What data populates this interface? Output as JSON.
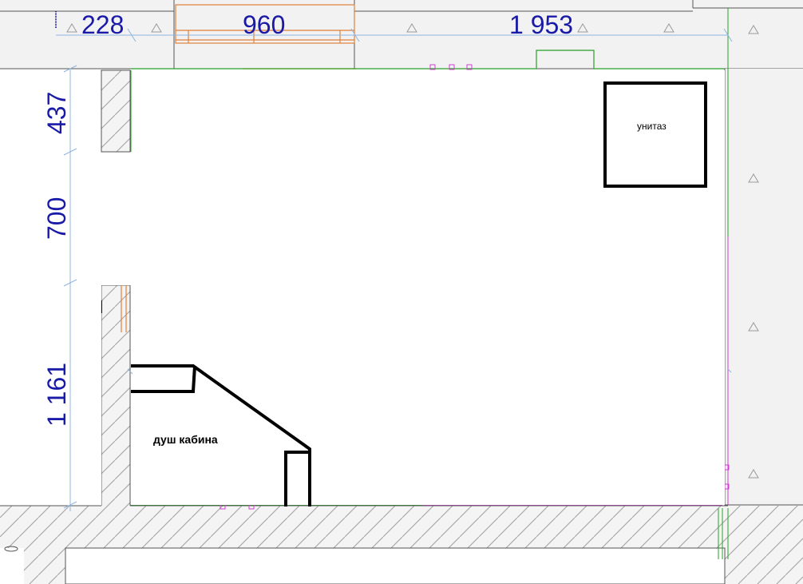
{
  "dimensions": {
    "top": [
      "228",
      "960",
      "1 953"
    ],
    "left": [
      "437",
      "700",
      "1 161"
    ]
  },
  "labels": {
    "toilet": "унитаз",
    "shower": "душ кабина"
  },
  "colors": {
    "dimension_text": "#1a1aa8",
    "dimension_line": "#8fb4e0",
    "wall_fill": "#f2f2f2",
    "hatch": "#9a9a9a",
    "door": "#e0803a",
    "green_line": "#2aa02a",
    "magenta_line": "#d040d0",
    "marker": "#999999"
  }
}
